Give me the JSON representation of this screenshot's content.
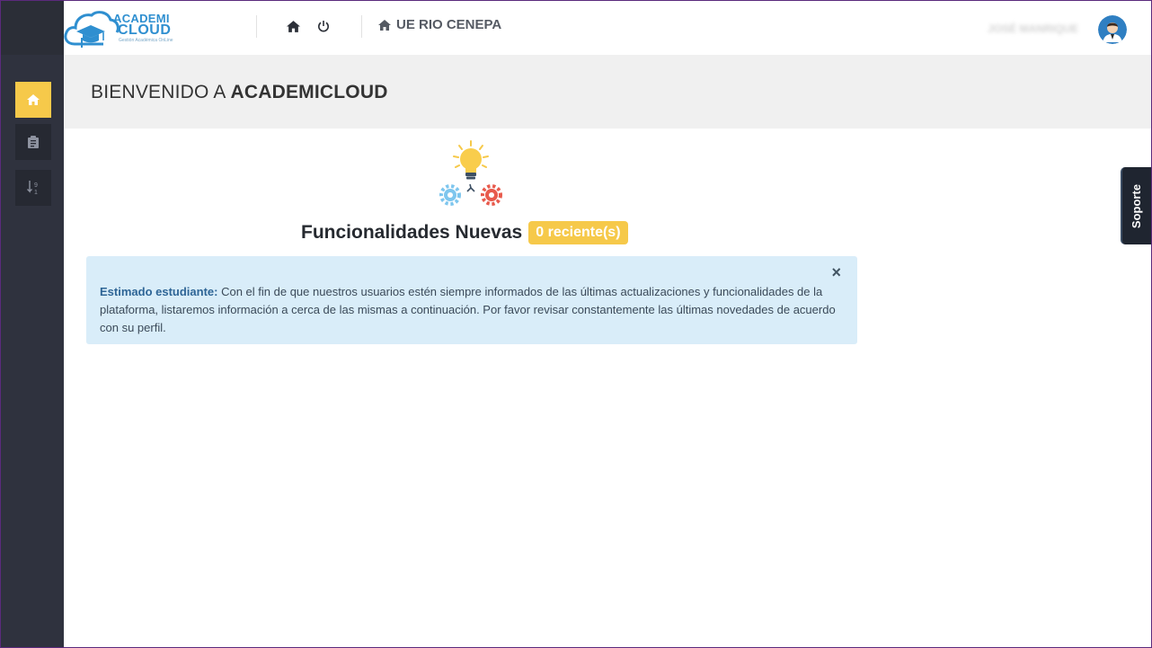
{
  "logo": {
    "line1": "ACADEMI",
    "line2": "CLOUD",
    "tagline": "Gestión Académica OnLine"
  },
  "header": {
    "school_name": "UE RIO CENEPA",
    "user_name": "JOSÉ MANRIQUE"
  },
  "sidebar": {
    "items": [
      {
        "name": "home",
        "icon": "home-icon",
        "active": true
      },
      {
        "name": "clipboard",
        "icon": "clipboard-icon",
        "active": false
      },
      {
        "name": "sort",
        "icon": "sort-numeric-icon",
        "active": false
      }
    ]
  },
  "welcome": {
    "prefix": "BIENVENIDO A",
    "brand": "ACADEMICLOUD"
  },
  "features": {
    "title": "Funcionalidades Nuevas",
    "badge": "0 reciente(s)"
  },
  "alert": {
    "lead": "Estimado estudiante:",
    "body": "Con el fin de que nuestros usuarios estén siempre informados de las últimas actualizaciones y funcionalidades de la plataforma, listaremos información a cerca de las mismas a continuación. Por favor revisar constantemente las últimas novedades de acuerdo con su perfil.",
    "close": "×"
  },
  "support_tab": "Soporte",
  "colors": {
    "accent": "#f6c94a",
    "sidebar": "#2f323e",
    "alert_bg": "#d9edf9",
    "brand_blue": "#2f8fd0"
  }
}
